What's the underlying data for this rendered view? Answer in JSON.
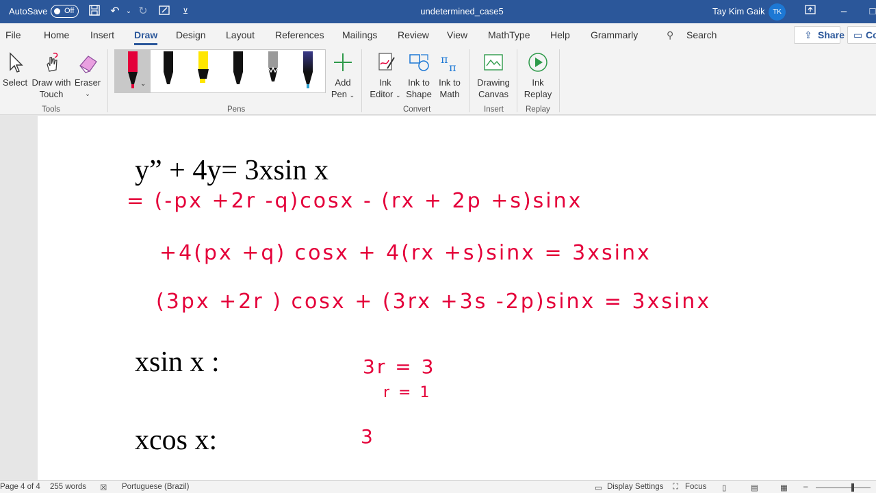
{
  "titlebar": {
    "autosave_label": "AutoSave",
    "autosave_state": "Off",
    "doc_title": "undetermined_case5",
    "user_name": "Tay Kim Gaik",
    "user_initials": "TK"
  },
  "tabs": [
    "File",
    "Home",
    "Insert",
    "Draw",
    "Design",
    "Layout",
    "References",
    "Mailings",
    "Review",
    "View",
    "MathType",
    "Help",
    "Grammarly"
  ],
  "active_tab": "Draw",
  "search_label": "Search",
  "share_label": "Share",
  "comments_label": "Co",
  "ribbon": {
    "tools": {
      "select": "Select",
      "draw_with_touch_1": "Draw with",
      "draw_with_touch_2": "Touch",
      "eraser": "Eraser",
      "group": "Tools"
    },
    "pens": {
      "group": "Pens",
      "add_pen_1": "Add",
      "add_pen_2": "Pen"
    },
    "convert": {
      "ink_editor_1": "Ink",
      "ink_editor_2": "Editor",
      "ink_to_shape_1": "Ink to",
      "ink_to_shape_2": "Shape",
      "ink_to_math_1": "Ink to",
      "ink_to_math_2": "Math",
      "group": "Convert"
    },
    "insert": {
      "drawing_canvas_1": "Drawing",
      "drawing_canvas_2": "Canvas",
      "group": "Insert"
    },
    "replay": {
      "ink_replay_1": "Ink",
      "ink_replay_2": "Replay",
      "group": "Replay"
    }
  },
  "document": {
    "equation": "y” + 4y= 3xsin x",
    "label_xsin": "xsin x :",
    "label_xcos": "xcos x:",
    "ink_line1": "= (-px +2r -q)cosx - (rx + 2p +s)sinx",
    "ink_line2": "+4(px +q) cosx + 4(rx +s)sinx = 3xsinx",
    "ink_line3": "(3px +2r ) cosx + (3rx +3s -2p)sinx = 3xsinx",
    "ink_r1": "3r = 3",
    "ink_r2": "r = 1",
    "ink_c1": "3"
  },
  "statusbar": {
    "page": "Page 4 of 4",
    "words": "255 words",
    "language": "Portuguese (Brazil)",
    "display_settings": "Display Settings",
    "focus": "Focus"
  },
  "colors": {
    "word_blue": "#2b579a",
    "ink_red": "#e4003a"
  }
}
